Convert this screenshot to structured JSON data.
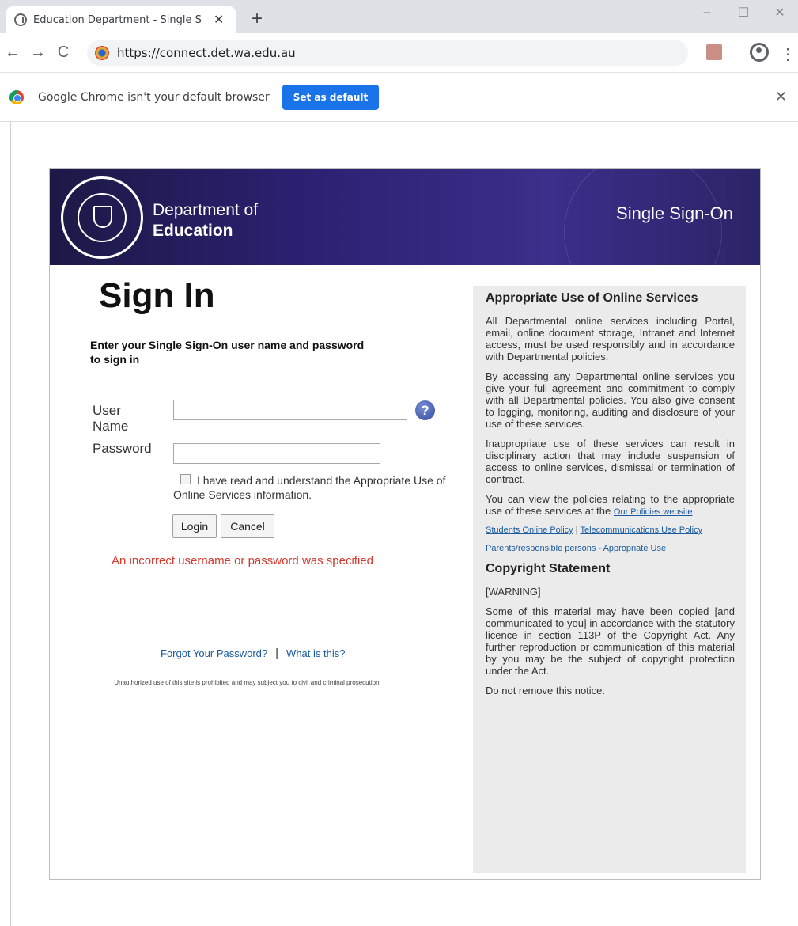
{
  "browser": {
    "tab_title": "Education Department - Single S",
    "new_tab": "+",
    "url": "https://connect.det.wa.edu.au",
    "infobar_text": "Google Chrome isn't your default browser",
    "infobar_button": "Set as default"
  },
  "banner": {
    "dept_line1": "Department of",
    "dept_line2": "Education",
    "service": "Single Sign-On"
  },
  "signin": {
    "title": "Sign In",
    "instructions": "Enter your Single Sign-On user name and password to sign in",
    "username_label": "User Name",
    "password_label": "Password",
    "username_value": "",
    "password_value": "",
    "help_symbol": "?",
    "agreement_text": "I have read and understand the Appropriate Use of Online Services information.",
    "login_button": "Login",
    "cancel_button": "Cancel",
    "error": "An incorrect username or password was specified",
    "forgot_link": "Forgot Your Password?",
    "what_link": "What is this?",
    "link_separator": "|",
    "disclaimer": "Unauthorized use of this site is prohibited and may subject you to civil and criminal prosecution."
  },
  "sidebar": {
    "heading": "Appropriate Use of Online Services",
    "p1": "All Departmental online services including Portal, email, online document storage, Intranet and Internet access, must be used responsibly and in accordance with Departmental policies.",
    "p2": "By accessing any Departmental online services you give your full agreement and commitment to comply with all Departmental policies. You also give consent to logging, monitoring, auditing and disclosure of your use of these services.",
    "p3": "Inappropriate use of these services can result in disciplinary action that may include suspension of access to online services, dismissal or termination of contract.",
    "p4_text": "You can view the policies relating to the appropriate use of these services at the",
    "p4_link": "Our Policies website",
    "students_link": "Students Online Policy",
    "policy_separator": "|",
    "telecom_link": "Telecommunications Use Policy",
    "parents_link": "Parents/responsible persons - Appropriate Use",
    "copyright_heading": "Copyright Statement",
    "warning": "[WARNING]",
    "copyright_text": "Some of this material may have been copied [and communicated to you] in accordance with the statutory licence in section 113P of the Copyright Act. Any further reproduction or communication of this material by you may be the subject of copyright protection under the Act.",
    "notice": "Do not remove this notice."
  },
  "colors": {
    "banner": "#2b2070",
    "error": "#d8372c",
    "link": "#1a5a9e",
    "chrome_button": "#1a73e8"
  }
}
